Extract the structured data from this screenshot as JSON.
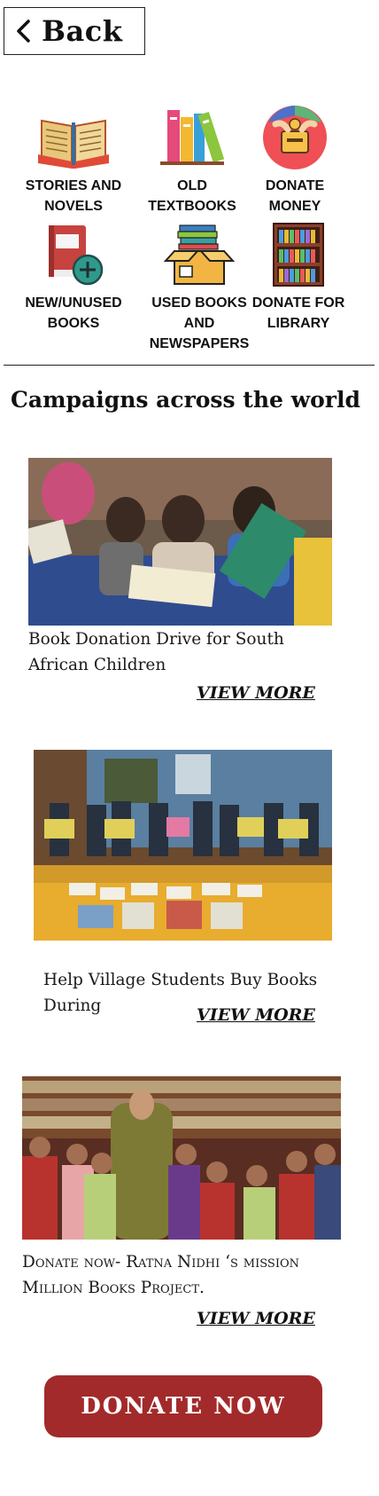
{
  "header": {
    "back_label": "Back"
  },
  "categories": [
    {
      "label": "STORIES AND\nNOVELS",
      "icon": "open-book-icon"
    },
    {
      "label": "OLD\nTEXTBOOKS",
      "icon": "book-stack-icon"
    },
    {
      "label": "DONATE\nMONEY",
      "icon": "donate-money-icon"
    },
    {
      "label": "NEW/UNUSED\nBOOKS",
      "icon": "add-book-icon"
    },
    {
      "label": "USED BOOKS\nAND\nNEWSPAPERS",
      "icon": "book-box-icon"
    },
    {
      "label": "DONATE FOR\nLIBRARY",
      "icon": "bookshelf-icon"
    }
  ],
  "campaigns_title": "Campaigns across the world",
  "campaigns": [
    {
      "caption": "Book Donation Drive for South African Children",
      "view_more": "VIEW MORE"
    },
    {
      "caption": "Help Village Students Buy Books During",
      "view_more": "VIEW MORE"
    },
    {
      "caption": "Donate now- Ratna Nidhi ‘s mission Million Books Project.",
      "view_more": "VIEW MORE"
    }
  ],
  "donate_button": "DONATE  NOW",
  "colors": {
    "donate_button": "#a22a2b",
    "text": "#111111"
  }
}
